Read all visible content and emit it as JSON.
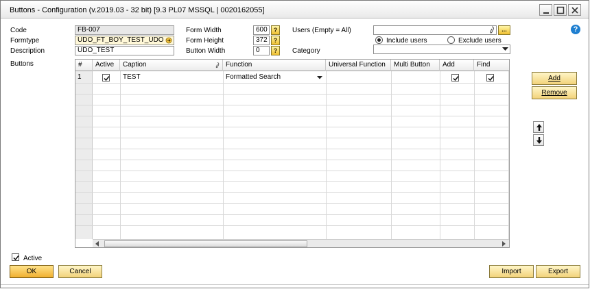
{
  "window": {
    "title": "Buttons - Configuration (v.2019.03 - 32 bit) [9.3 PL07 MSSQL | 0020162055]"
  },
  "form": {
    "code_label": "Code",
    "code_value": "FB-007",
    "formtype_label": "Formtype",
    "formtype_value": "UDO_FT_BOY_TEST_UDO",
    "description_label": "Description",
    "description_value": "UDO_TEST",
    "buttons_label": "Buttons",
    "form_width_label": "Form Width",
    "form_width_value": "600",
    "form_height_label": "Form Height",
    "form_height_value": "372",
    "button_width_label": "Button Width",
    "button_width_value": "0",
    "question_glyph": "?",
    "users_label": "Users (Empty = All)",
    "users_value": "",
    "users_browse": "...",
    "include_users_label": "Include users",
    "exclude_users_label": "Exclude users",
    "category_label": "Category",
    "category_value": ""
  },
  "grid": {
    "columns": [
      "#",
      "Active",
      "Caption",
      "Function",
      "Universal Function",
      "Multi Button",
      "Add",
      "Find"
    ],
    "rows": [
      {
        "num": "1",
        "active": true,
        "caption": "TEST",
        "function": "Formatted Search",
        "universal_function": "",
        "multi_button": "",
        "add": true,
        "find": true
      }
    ]
  },
  "side_buttons": {
    "add": "Add",
    "remove": "Remove"
  },
  "footer": {
    "active_label": "Active",
    "ok": "OK",
    "cancel": "Cancel",
    "import": "Import",
    "export": "Export"
  },
  "colors": {
    "accent_button": "#f2d27a",
    "help_icon": "#1f7fd0",
    "link_field": "#fff8d8"
  }
}
